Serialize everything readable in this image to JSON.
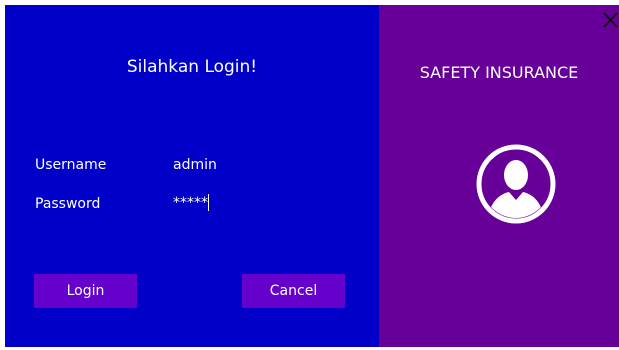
{
  "login": {
    "heading": "Silahkan Login!",
    "username_label": "Username",
    "username_value": "admin",
    "password_label": "Password",
    "password_value": "*****",
    "login_label": "Login",
    "cancel_label": "Cancel"
  },
  "brand": {
    "title": "SAFETY INSURANCE"
  },
  "icons": {
    "close": "close-icon",
    "avatar": "user-avatar-icon"
  },
  "colors": {
    "left_panel": "#0000c8",
    "right_panel": "#660099",
    "button": "#6600cc",
    "text": "#ffffff"
  }
}
